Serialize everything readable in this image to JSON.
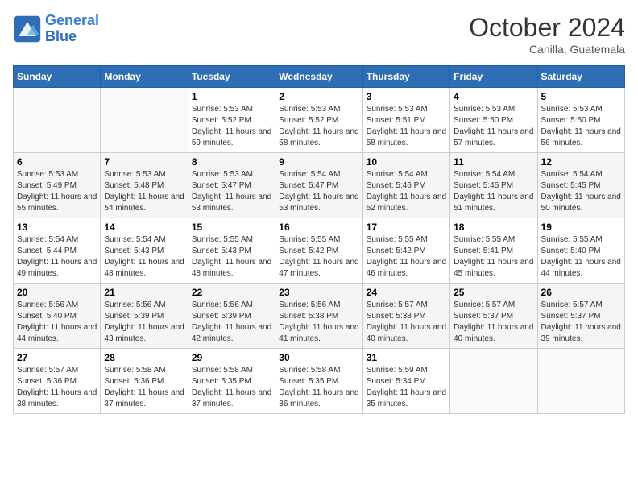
{
  "header": {
    "logo_line1": "General",
    "logo_line2": "Blue",
    "month_title": "October 2024",
    "subtitle": "Canilla, Guatemala"
  },
  "weekdays": [
    "Sunday",
    "Monday",
    "Tuesday",
    "Wednesday",
    "Thursday",
    "Friday",
    "Saturday"
  ],
  "weeks": [
    [
      {
        "day": "",
        "sunrise": "",
        "sunset": "",
        "daylight": ""
      },
      {
        "day": "",
        "sunrise": "",
        "sunset": "",
        "daylight": ""
      },
      {
        "day": "1",
        "sunrise": "Sunrise: 5:53 AM",
        "sunset": "Sunset: 5:52 PM",
        "daylight": "Daylight: 11 hours and 59 minutes."
      },
      {
        "day": "2",
        "sunrise": "Sunrise: 5:53 AM",
        "sunset": "Sunset: 5:52 PM",
        "daylight": "Daylight: 11 hours and 58 minutes."
      },
      {
        "day": "3",
        "sunrise": "Sunrise: 5:53 AM",
        "sunset": "Sunset: 5:51 PM",
        "daylight": "Daylight: 11 hours and 58 minutes."
      },
      {
        "day": "4",
        "sunrise": "Sunrise: 5:53 AM",
        "sunset": "Sunset: 5:50 PM",
        "daylight": "Daylight: 11 hours and 57 minutes."
      },
      {
        "day": "5",
        "sunrise": "Sunrise: 5:53 AM",
        "sunset": "Sunset: 5:50 PM",
        "daylight": "Daylight: 11 hours and 56 minutes."
      }
    ],
    [
      {
        "day": "6",
        "sunrise": "Sunrise: 5:53 AM",
        "sunset": "Sunset: 5:49 PM",
        "daylight": "Daylight: 11 hours and 55 minutes."
      },
      {
        "day": "7",
        "sunrise": "Sunrise: 5:53 AM",
        "sunset": "Sunset: 5:48 PM",
        "daylight": "Daylight: 11 hours and 54 minutes."
      },
      {
        "day": "8",
        "sunrise": "Sunrise: 5:53 AM",
        "sunset": "Sunset: 5:47 PM",
        "daylight": "Daylight: 11 hours and 53 minutes."
      },
      {
        "day": "9",
        "sunrise": "Sunrise: 5:54 AM",
        "sunset": "Sunset: 5:47 PM",
        "daylight": "Daylight: 11 hours and 53 minutes."
      },
      {
        "day": "10",
        "sunrise": "Sunrise: 5:54 AM",
        "sunset": "Sunset: 5:46 PM",
        "daylight": "Daylight: 11 hours and 52 minutes."
      },
      {
        "day": "11",
        "sunrise": "Sunrise: 5:54 AM",
        "sunset": "Sunset: 5:45 PM",
        "daylight": "Daylight: 11 hours and 51 minutes."
      },
      {
        "day": "12",
        "sunrise": "Sunrise: 5:54 AM",
        "sunset": "Sunset: 5:45 PM",
        "daylight": "Daylight: 11 hours and 50 minutes."
      }
    ],
    [
      {
        "day": "13",
        "sunrise": "Sunrise: 5:54 AM",
        "sunset": "Sunset: 5:44 PM",
        "daylight": "Daylight: 11 hours and 49 minutes."
      },
      {
        "day": "14",
        "sunrise": "Sunrise: 5:54 AM",
        "sunset": "Sunset: 5:43 PM",
        "daylight": "Daylight: 11 hours and 48 minutes."
      },
      {
        "day": "15",
        "sunrise": "Sunrise: 5:55 AM",
        "sunset": "Sunset: 5:43 PM",
        "daylight": "Daylight: 11 hours and 48 minutes."
      },
      {
        "day": "16",
        "sunrise": "Sunrise: 5:55 AM",
        "sunset": "Sunset: 5:42 PM",
        "daylight": "Daylight: 11 hours and 47 minutes."
      },
      {
        "day": "17",
        "sunrise": "Sunrise: 5:55 AM",
        "sunset": "Sunset: 5:42 PM",
        "daylight": "Daylight: 11 hours and 46 minutes."
      },
      {
        "day": "18",
        "sunrise": "Sunrise: 5:55 AM",
        "sunset": "Sunset: 5:41 PM",
        "daylight": "Daylight: 11 hours and 45 minutes."
      },
      {
        "day": "19",
        "sunrise": "Sunrise: 5:55 AM",
        "sunset": "Sunset: 5:40 PM",
        "daylight": "Daylight: 11 hours and 44 minutes."
      }
    ],
    [
      {
        "day": "20",
        "sunrise": "Sunrise: 5:56 AM",
        "sunset": "Sunset: 5:40 PM",
        "daylight": "Daylight: 11 hours and 44 minutes."
      },
      {
        "day": "21",
        "sunrise": "Sunrise: 5:56 AM",
        "sunset": "Sunset: 5:39 PM",
        "daylight": "Daylight: 11 hours and 43 minutes."
      },
      {
        "day": "22",
        "sunrise": "Sunrise: 5:56 AM",
        "sunset": "Sunset: 5:39 PM",
        "daylight": "Daylight: 11 hours and 42 minutes."
      },
      {
        "day": "23",
        "sunrise": "Sunrise: 5:56 AM",
        "sunset": "Sunset: 5:38 PM",
        "daylight": "Daylight: 11 hours and 41 minutes."
      },
      {
        "day": "24",
        "sunrise": "Sunrise: 5:57 AM",
        "sunset": "Sunset: 5:38 PM",
        "daylight": "Daylight: 11 hours and 40 minutes."
      },
      {
        "day": "25",
        "sunrise": "Sunrise: 5:57 AM",
        "sunset": "Sunset: 5:37 PM",
        "daylight": "Daylight: 11 hours and 40 minutes."
      },
      {
        "day": "26",
        "sunrise": "Sunrise: 5:57 AM",
        "sunset": "Sunset: 5:37 PM",
        "daylight": "Daylight: 11 hours and 39 minutes."
      }
    ],
    [
      {
        "day": "27",
        "sunrise": "Sunrise: 5:57 AM",
        "sunset": "Sunset: 5:36 PM",
        "daylight": "Daylight: 11 hours and 38 minutes."
      },
      {
        "day": "28",
        "sunrise": "Sunrise: 5:58 AM",
        "sunset": "Sunset: 5:36 PM",
        "daylight": "Daylight: 11 hours and 37 minutes."
      },
      {
        "day": "29",
        "sunrise": "Sunrise: 5:58 AM",
        "sunset": "Sunset: 5:35 PM",
        "daylight": "Daylight: 11 hours and 37 minutes."
      },
      {
        "day": "30",
        "sunrise": "Sunrise: 5:58 AM",
        "sunset": "Sunset: 5:35 PM",
        "daylight": "Daylight: 11 hours and 36 minutes."
      },
      {
        "day": "31",
        "sunrise": "Sunrise: 5:59 AM",
        "sunset": "Sunset: 5:34 PM",
        "daylight": "Daylight: 11 hours and 35 minutes."
      },
      {
        "day": "",
        "sunrise": "",
        "sunset": "",
        "daylight": ""
      },
      {
        "day": "",
        "sunrise": "",
        "sunset": "",
        "daylight": ""
      }
    ]
  ]
}
